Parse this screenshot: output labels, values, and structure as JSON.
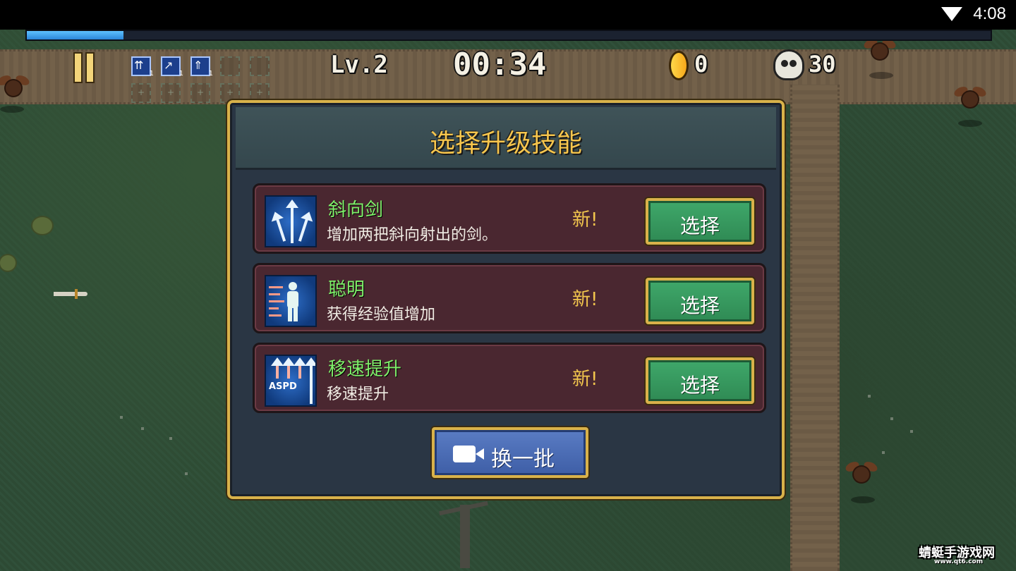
{
  "status_bar": {
    "time": "4:08",
    "wifi_icon": "wifi-icon"
  },
  "hud": {
    "xp_progress": 0.1,
    "level": "Lv.2",
    "timer": "00:34",
    "coins": "0",
    "kills": "30",
    "skill_slots": [
      {
        "icon": "double-arrow-icon",
        "glyph": "⇈",
        "level": "1"
      },
      {
        "icon": "diagonal-sword-icon",
        "glyph": "↗",
        "level": "1"
      },
      {
        "icon": "speed-up-icon",
        "glyph": "⇑",
        "level": "1"
      }
    ]
  },
  "modal": {
    "title": "选择升级技能",
    "options": [
      {
        "icon": "triple-arrow-icon",
        "name": "斜向剑",
        "description": "增加两把斜向射出的剑。",
        "badge": "新!",
        "button": "选择"
      },
      {
        "icon": "running-figure-icon",
        "name": "聪明",
        "description": "获得经验值增加",
        "badge": "新!",
        "button": "选择"
      },
      {
        "icon": "aspd-up-icon",
        "icon_text": "ASPD",
        "name": "移速提升",
        "description": "移速提升",
        "badge": "新!",
        "button": "选择"
      }
    ],
    "reroll_button": "换一批",
    "reroll_icon": "video-camera-icon"
  },
  "watermark": {
    "text": "蜻蜓手游戏网",
    "sub": "www.qt6.com"
  },
  "colors": {
    "accent_gold": "#d9b24a",
    "name_green": "#7ff06a",
    "select_green": "#3fa86a",
    "reroll_blue": "#4a6cb4"
  }
}
